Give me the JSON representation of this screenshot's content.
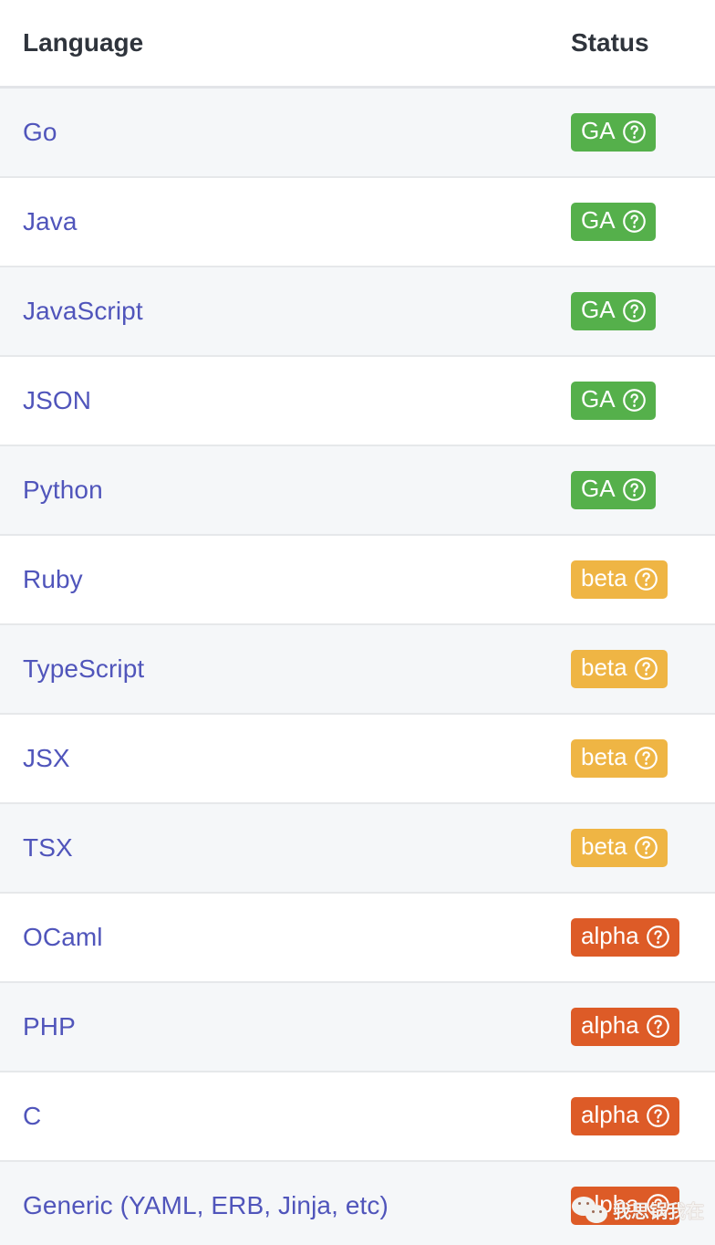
{
  "table": {
    "columns": [
      {
        "key": "language",
        "label": "Language"
      },
      {
        "key": "status",
        "label": "Status"
      }
    ],
    "rows": [
      {
        "language": "Go",
        "status": "GA",
        "status_level": "ga",
        "help": "?"
      },
      {
        "language": "Java",
        "status": "GA",
        "status_level": "ga",
        "help": "?"
      },
      {
        "language": "JavaScript",
        "status": "GA",
        "status_level": "ga",
        "help": "?"
      },
      {
        "language": "JSON",
        "status": "GA",
        "status_level": "ga",
        "help": "?"
      },
      {
        "language": "Python",
        "status": "GA",
        "status_level": "ga",
        "help": "?"
      },
      {
        "language": "Ruby",
        "status": "beta",
        "status_level": "beta",
        "help": "?"
      },
      {
        "language": "TypeScript",
        "status": "beta",
        "status_level": "beta",
        "help": "?"
      },
      {
        "language": "JSX",
        "status": "beta",
        "status_level": "beta",
        "help": "?"
      },
      {
        "language": "TSX",
        "status": "beta",
        "status_level": "beta",
        "help": "?"
      },
      {
        "language": "OCaml",
        "status": "alpha",
        "status_level": "alpha",
        "help": "?"
      },
      {
        "language": "PHP",
        "status": "alpha",
        "status_level": "alpha",
        "help": "?"
      },
      {
        "language": "C",
        "status": "alpha",
        "status_level": "alpha",
        "help": "?"
      },
      {
        "language": "Generic (YAML, ERB, Jinja, etc)",
        "status": "alpha",
        "status_level": "alpha",
        "help": "?"
      }
    ]
  },
  "colors": {
    "ga": "#55b04b",
    "beta": "#efb544",
    "alpha": "#dd5b27",
    "link": "#5055bb",
    "header_text": "#2f343c",
    "row_shaded": "#f5f7f9",
    "row_plain": "#ffffff",
    "row_border": "#e6e8ea"
  },
  "watermark": {
    "text": "我思锅我在",
    "logo": "wechat-logo"
  }
}
